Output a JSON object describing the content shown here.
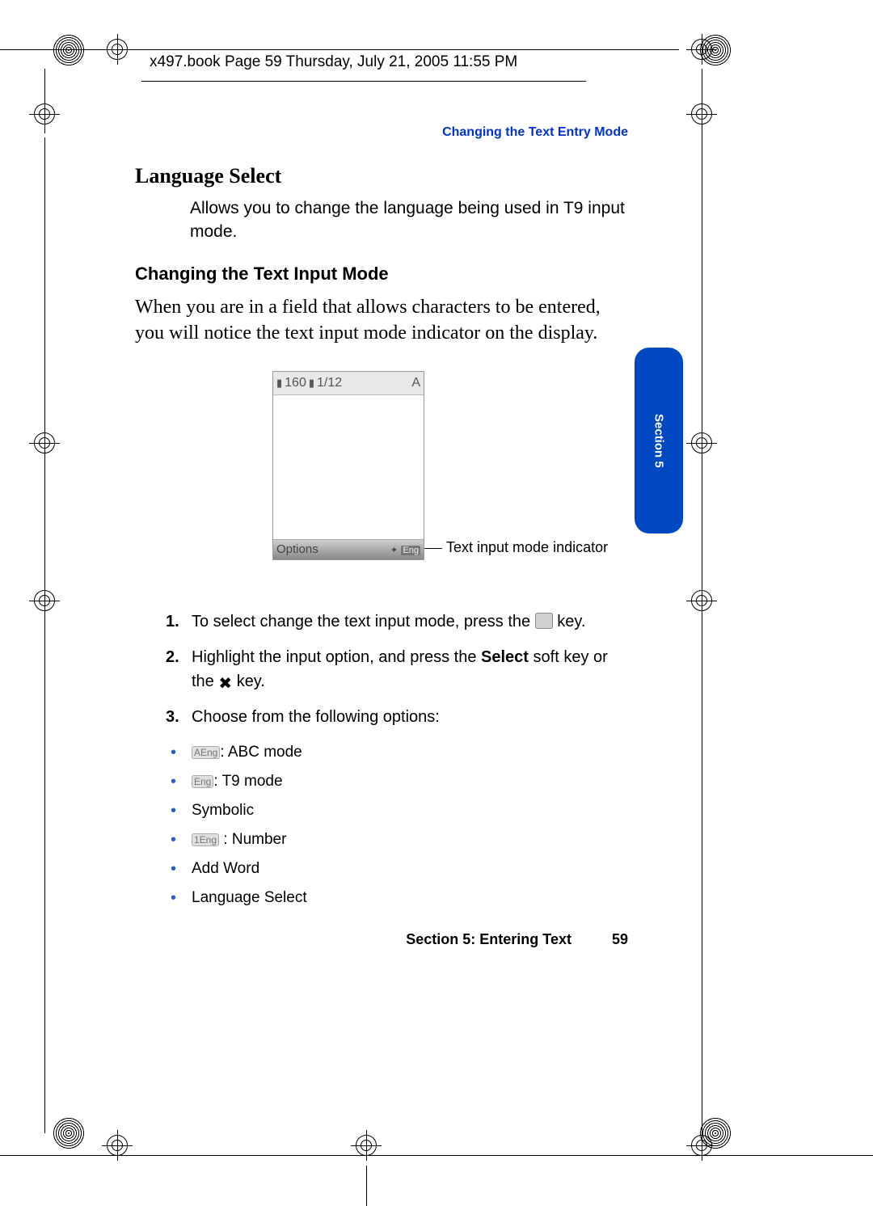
{
  "header": {
    "text": "x497.book  Page 59  Thursday, July 21, 2005  11:55 PM"
  },
  "running_header": "Changing the Text Entry Mode",
  "section_tab": "Section 5",
  "h1": "Language Select",
  "p1": "Allows you to change the language being used in T9 input mode.",
  "h2": "Changing the Text Input Mode",
  "p2": "When you are in a field that allows characters to be entered, you will notice the text input mode indicator on the display.",
  "phone": {
    "status_count": "160",
    "status_page": "1/12",
    "status_right": "A",
    "soft_left": "Options",
    "soft_right": "Eng"
  },
  "callout": "Text input mode indicator",
  "steps": [
    {
      "num": "1.",
      "text_a": "To select change the text input mode, press the ",
      "text_b": " key."
    },
    {
      "num": "2.",
      "text_a": "Highlight the input option, and press the ",
      "bold": "Select",
      "text_b": " soft key or the ",
      "text_c": " key."
    },
    {
      "num": "3.",
      "text_a": "Choose from the following options:"
    }
  ],
  "bullets": [
    {
      "pill": "AEng",
      "text": ": ABC mode"
    },
    {
      "pill": "Eng",
      "text": ": T9 mode"
    },
    {
      "text": "Symbolic"
    },
    {
      "pill": "1Eng",
      "text": " : Number"
    },
    {
      "text": "Add Word"
    },
    {
      "text": "Language Select"
    }
  ],
  "footer": {
    "section": "Section 5: Entering Text",
    "page": "59"
  }
}
